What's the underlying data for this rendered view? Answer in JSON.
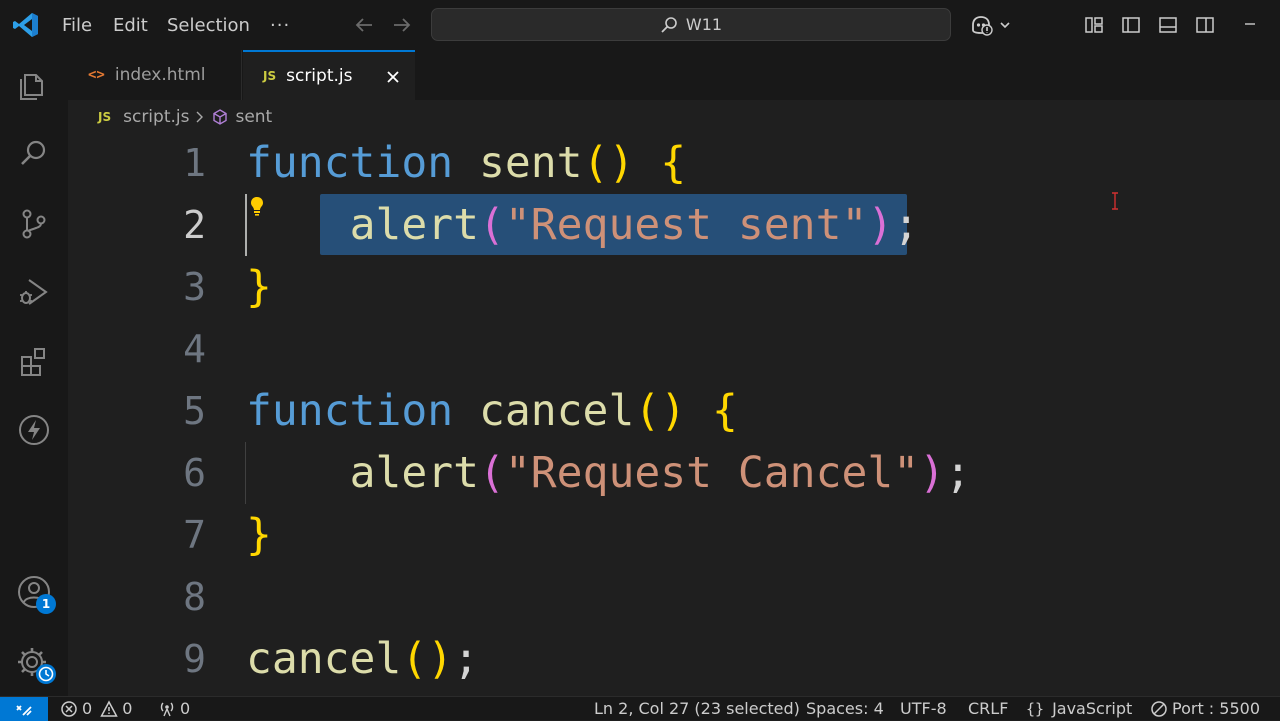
{
  "titlebar": {
    "menu": [
      "File",
      "Edit",
      "Selection",
      "···"
    ],
    "search_text": "W11"
  },
  "tabs": [
    {
      "icon": "html-file-icon",
      "label": "index.html",
      "active": false
    },
    {
      "icon": "js-file-icon",
      "label": "script.js",
      "active": true
    }
  ],
  "breadcrumb": {
    "file_icon_text": "JS",
    "file": "script.js",
    "separator": ">",
    "symbol": "sent"
  },
  "editor": {
    "language": "javascript",
    "active_line": 2,
    "selection": "alert(\"Request sent\");",
    "lines": [
      {
        "n": "1",
        "text": "function sent() {"
      },
      {
        "n": "2",
        "text": "    alert(\"Request sent\");"
      },
      {
        "n": "3",
        "text": "}"
      },
      {
        "n": "4",
        "text": ""
      },
      {
        "n": "5",
        "text": "function cancel() {"
      },
      {
        "n": "6",
        "text": "    alert(\"Request Cancel\");"
      },
      {
        "n": "7",
        "text": "}"
      },
      {
        "n": "8",
        "text": ""
      },
      {
        "n": "9",
        "text": "cancel();"
      }
    ]
  },
  "activity_bar": {
    "items": [
      "files-icon",
      "search-icon",
      "source-control-icon",
      "run-debug-icon",
      "extensions-icon",
      "live-share-icon"
    ],
    "accounts_badge": "1"
  },
  "statusbar": {
    "errors": "0",
    "warnings": "0",
    "ports": "0",
    "position": "Ln 2, Col 27 (23 selected)",
    "spaces": "Spaces: 4",
    "encoding": "UTF-8",
    "eol": "CRLF",
    "language": "JavaScript",
    "live_server": "Port : 5500"
  },
  "colors": {
    "accent": "#0078d4",
    "keyword": "#569cd6",
    "function": "#dcdcaa",
    "string": "#ce9178",
    "bracket_level1": "#ffd700",
    "bracket_level2": "#da70d6",
    "selection": "#264f78"
  }
}
